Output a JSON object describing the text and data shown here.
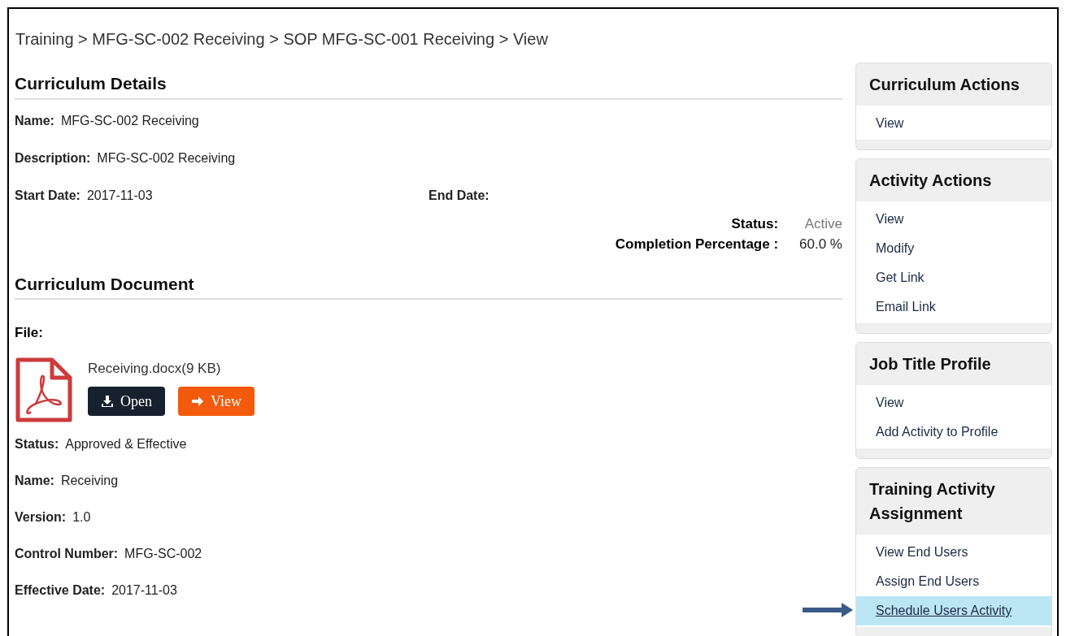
{
  "breadcrumb": "Training > MFG-SC-002 Receiving > SOP MFG-SC-001 Receiving > View",
  "curriculum_details": {
    "title": "Curriculum Details",
    "fields": [
      {
        "label": "Name:",
        "value": "MFG-SC-002 Receiving"
      },
      {
        "label": "Description:",
        "value": "MFG-SC-002 Receiving"
      }
    ],
    "dates": [
      {
        "label": "Start Date:",
        "value": "2017-11-03"
      },
      {
        "label": "End Date:"
      }
    ],
    "summary": [
      {
        "label": "Status:",
        "value": "Active",
        "kind": "status"
      },
      {
        "label": "Completion Percentage :",
        "value": "60.0 %",
        "kind": "plain"
      }
    ]
  },
  "curriculum_document": {
    "title": "Curriculum Document",
    "file_label": "File:",
    "file_name": "Receiving.docx(9 KB)",
    "buttons": [
      {
        "label": "Open",
        "kind": "open"
      },
      {
        "label": "View",
        "kind": "view"
      }
    ],
    "fields": [
      {
        "label": "Status:",
        "value": "Approved & Effective"
      },
      {
        "label": "Name:",
        "value": "Receiving"
      },
      {
        "label": "Version:",
        "value": "1.0"
      },
      {
        "label": "Control Number:",
        "value": "MFG-SC-002"
      },
      {
        "label": "Effective Date:",
        "value": "2017-11-03"
      }
    ]
  },
  "sidebar": [
    {
      "title": "Curriculum Actions",
      "items": [
        {
          "label": "View",
          "selected": false
        }
      ]
    },
    {
      "title": "Activity Actions",
      "items": [
        {
          "label": "View",
          "selected": false
        },
        {
          "label": "Modify",
          "selected": false
        },
        {
          "label": "Get Link",
          "selected": false
        },
        {
          "label": "Email Link",
          "selected": false
        }
      ]
    },
    {
      "title": "Job Title Profile",
      "items": [
        {
          "label": "View",
          "selected": false
        },
        {
          "label": "Add Activity to Profile",
          "selected": false
        }
      ]
    },
    {
      "title": "Training Activity Assignment",
      "items": [
        {
          "label": "View End Users",
          "selected": false
        },
        {
          "label": "Assign End Users",
          "selected": false
        },
        {
          "label": "Schedule Users Activity",
          "selected": true
        }
      ]
    }
  ]
}
